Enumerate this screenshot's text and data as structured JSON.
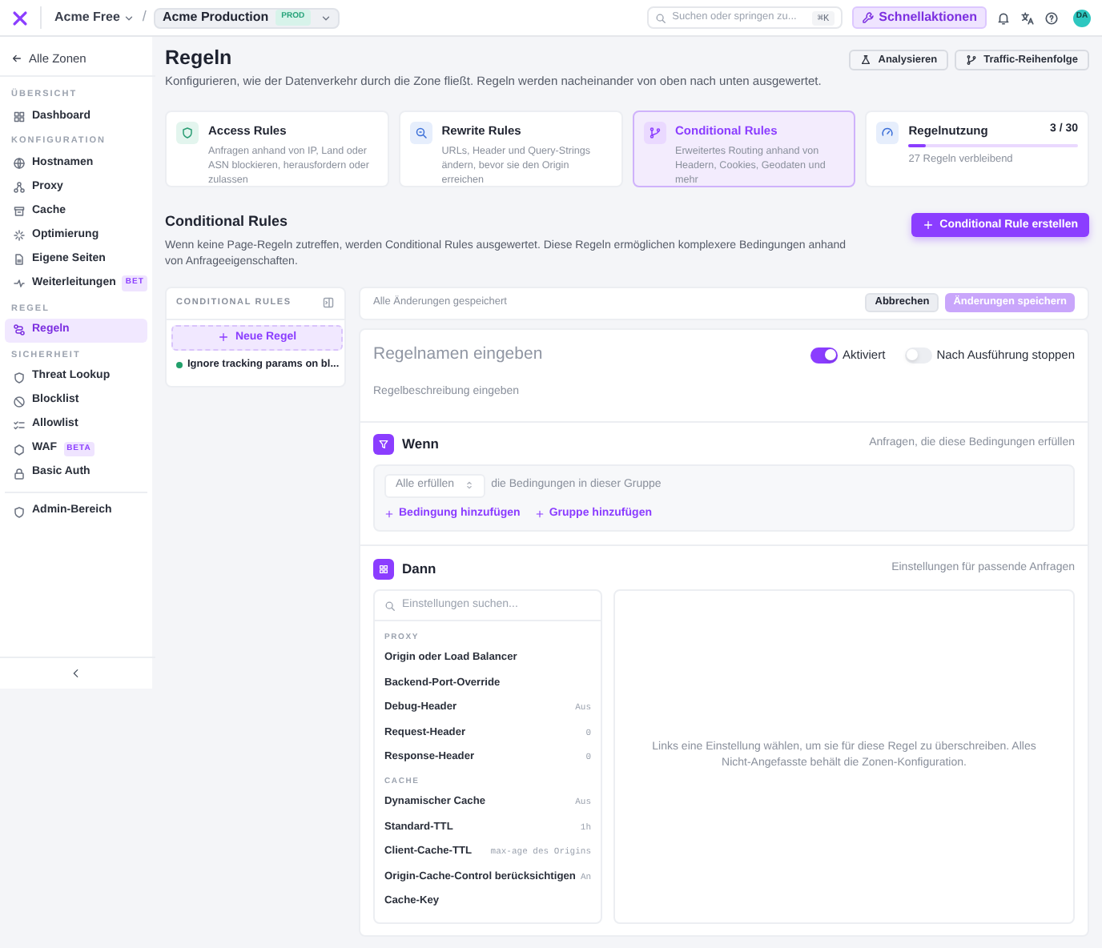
{
  "topbar": {
    "org": "Acme Free",
    "separator": "/",
    "zone": "Acme Production",
    "zone_badge": "PROD",
    "search": {
      "placeholder": "Suchen oder springen zu...",
      "shortcut": "⌘K"
    },
    "quick_actions": "Schnellaktionen",
    "avatar": "DA"
  },
  "sidebar": {
    "back": "Alle Zonen",
    "items": [
      {
        "kind": "section",
        "label": "ÜBERSICHT"
      },
      {
        "kind": "item",
        "label": "Dashboard",
        "selected": false
      },
      {
        "kind": "section",
        "label": "KONFIGURATION"
      },
      {
        "kind": "item",
        "label": "Hostnamen",
        "selected": false
      },
      {
        "kind": "item",
        "label": "Proxy",
        "selected": false
      },
      {
        "kind": "item",
        "label": "Cache",
        "selected": false
      },
      {
        "kind": "item",
        "label": "Optimierung",
        "selected": false
      },
      {
        "kind": "item",
        "label": "Eigene Seiten",
        "selected": false
      },
      {
        "kind": "item",
        "label": "Weiterleitungen",
        "selected": false,
        "badge": "BET"
      },
      {
        "kind": "section",
        "label": "REGEL"
      },
      {
        "kind": "item",
        "label": "Regeln",
        "selected": true
      },
      {
        "kind": "section",
        "label": "SICHERHEIT"
      },
      {
        "kind": "item",
        "label": "Threat Lookup",
        "selected": false
      },
      {
        "kind": "item",
        "label": "Blocklist",
        "selected": false
      },
      {
        "kind": "item",
        "label": "Allowlist",
        "selected": false
      },
      {
        "kind": "item",
        "label": "WAF",
        "selected": false,
        "badge": "BETA"
      },
      {
        "kind": "item",
        "label": "Basic Auth",
        "selected": false
      },
      {
        "kind": "divider"
      },
      {
        "kind": "item",
        "label": "Admin-Bereich",
        "selected": false
      }
    ]
  },
  "header": {
    "title": "Regeln",
    "subtitle": "Konfigurieren, wie der Datenverkehr durch die Zone fließt. Regeln werden nacheinander von oben nach unten ausgewertet.",
    "buttons": [
      "Analysieren",
      "Traffic-Reihenfolge"
    ]
  },
  "cards": [
    {
      "kind": "type",
      "title": "Access Rules",
      "description": "Anfragen anhand von IP, Land oder ASN blockieren, herausfordern oder zulassen",
      "selected": false
    },
    {
      "kind": "type",
      "title": "Rewrite Rules",
      "description": "URLs, Header und Query-Strings ändern, bevor sie den Origin erreichen",
      "selected": false
    },
    {
      "kind": "type",
      "title": "Conditional Rules",
      "description": "Erweitertes Routing anhand von Headern, Cookies, Geodaten und mehr",
      "selected": true
    },
    {
      "kind": "usage",
      "title": "Regelnutzung",
      "count": "3 / 30",
      "level": 0.1,
      "description": "27 Regeln verbleibend"
    }
  ],
  "section": {
    "title": "Conditional Rules",
    "description": "Wenn keine Page-Regeln zutreffen, werden Conditional Rules ausgewertet. Diese Regeln ermöglichen komplexere Bedingungen anhand von Anfrageeigenschaften.",
    "create_button": "Conditional Rule erstellen"
  },
  "rule_list": {
    "title": "CONDITIONAL RULES",
    "new_button": "Neue Regel",
    "rules": [
      {
        "name": "Ignore tracking params on bl...",
        "enabled": true,
        "selected": false
      }
    ]
  },
  "editor": {
    "status": "Alle Änderungen gespeichert",
    "cancel": "Abbrechen",
    "save": "Änderungen speichern",
    "name_placeholder": "Regelnamen eingeben",
    "description_placeholder": "Regelbeschreibung eingeben",
    "toggles": [
      {
        "label": "Aktiviert",
        "on": true
      },
      {
        "label": "Nach Ausführung stoppen",
        "on": false
      }
    ],
    "when": {
      "title": "Wenn",
      "hint": "Anfragen, die diese Bedingungen erfüllen",
      "match": "Alle erfüllen",
      "match_text": "die Bedingungen in dieser Gruppe",
      "actions": [
        "Bedingung hinzufügen",
        "Gruppe hinzufügen"
      ]
    },
    "then": {
      "title": "Dann",
      "hint": "Einstellungen für passende Anfragen",
      "search_placeholder": "Einstellungen suchen...",
      "empty": "Links eine Einstellung wählen, um sie für diese Regel zu überschreiben. Alles Nicht-Angefasste behält die Zonen-Konfiguration.",
      "groups": [
        {
          "label": "PROXY",
          "settings": [
            {
              "name": "Origin oder Load Balancer"
            },
            {
              "name": "Backend-Port-Override"
            },
            {
              "name": "Debug-Header",
              "value": "Aus"
            },
            {
              "name": "Request-Header",
              "value": "0"
            },
            {
              "name": "Response-Header",
              "value": "0"
            }
          ]
        },
        {
          "label": "CACHE",
          "settings": [
            {
              "name": "Dynamischer Cache",
              "value": "Aus"
            },
            {
              "name": "Standard-TTL",
              "value": "1h"
            },
            {
              "name": "Client-Cache-TTL",
              "value": "max-age des Origins"
            },
            {
              "name": "Origin-Cache-Control berücksichtigen",
              "value": "An"
            },
            {
              "name": "Cache-Key"
            }
          ]
        }
      ]
    }
  }
}
